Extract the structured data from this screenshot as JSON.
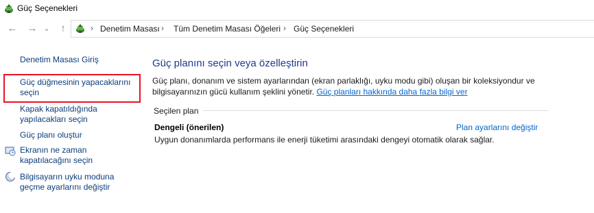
{
  "window": {
    "title": "Güç Seçenekleri"
  },
  "nav": {
    "back_glyph": "←",
    "forward_glyph": "→",
    "recent_glyph": "⌄",
    "up_glyph": "↑",
    "breadcrumb_sep_glyph": "›",
    "breadcrumbs": [
      "Denetim Masası",
      "Tüm Denetim Masası Öğeleri",
      "Güç Seçenekleri"
    ]
  },
  "sidebar": {
    "home_label": "Denetim Masası Giriş",
    "items": [
      {
        "line1": "Güç düğmesinin yapacaklarını",
        "line2": "seçin",
        "icon": ""
      },
      {
        "line1": "Kapak kapatıldığında",
        "line2": "yapılacakları seçin",
        "icon": ""
      },
      {
        "line1": "Güç planı oluştur",
        "line2": "",
        "icon": ""
      },
      {
        "line1": "Ekranın ne zaman",
        "line2": "kapatılacağını seçin",
        "icon": "monitor-clock-icon"
      },
      {
        "line1": "Bilgisayarın uyku moduna",
        "line2": "geçme ayarlarını değiştir",
        "icon": "moon-sleep-icon"
      }
    ]
  },
  "main": {
    "heading": "Güç planını seçin veya özelleştirin",
    "desc_line1": "Güç planı, donanım ve sistem ayarlarından (ekran parlaklığı, uyku modu gibi) oluşan bir koleksiyondur ve",
    "desc_line2": "bilgisayarınızın gücü kullanım şeklini yönetir.",
    "desc_link": "Güç planları hakkında daha fazla bilgi ver",
    "group_label": "Seçilen plan",
    "plan": {
      "name": "Dengeli (önerilen)",
      "settings_link": "Plan ayarlarını değiştir",
      "description": "Uygun donanımlarda performans ile enerji tüketimi arasındaki dengeyi otomatik olarak sağlar."
    }
  },
  "colors": {
    "link": "#0066cc",
    "nav_link": "#0b3c7a",
    "heading": "#1e3a8a",
    "highlight_border": "#e81123"
  }
}
